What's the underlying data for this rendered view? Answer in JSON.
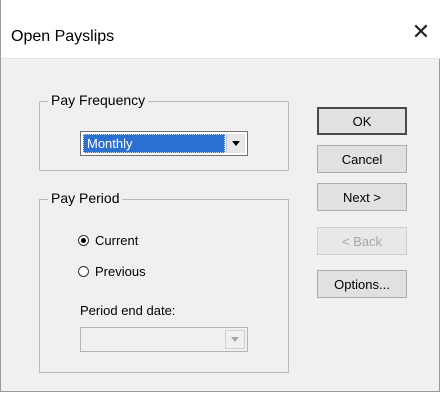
{
  "window": {
    "title": "Open Payslips",
    "close_glyph": "✕"
  },
  "pay_frequency": {
    "label": "Pay Frequency",
    "selected": "Monthly"
  },
  "pay_period": {
    "label": "Pay Period",
    "options": [
      {
        "label": "Current",
        "checked": true
      },
      {
        "label": "Previous",
        "checked": false
      }
    ],
    "end_date_label": "Period end date:",
    "end_date_value": ""
  },
  "buttons": {
    "ok": "OK",
    "cancel": "Cancel",
    "next": "Next >",
    "back": "< Back",
    "options": "Options..."
  },
  "icons": {
    "close": "close-icon",
    "dropdown": "chevron-down-icon"
  }
}
